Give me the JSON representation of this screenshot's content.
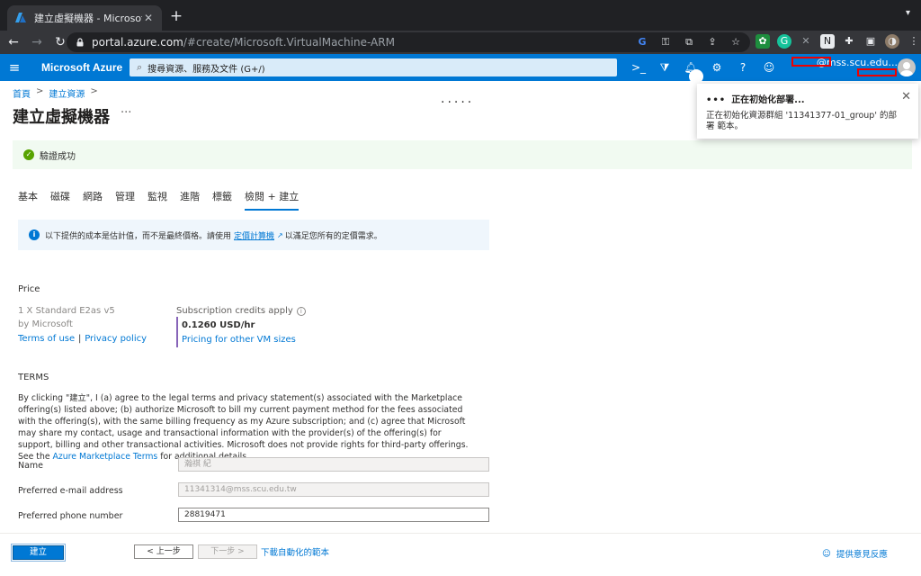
{
  "browser": {
    "tab_title": "建立虛擬機器 - Microsoft Azure",
    "tab_close": "✕",
    "new_tab": "+",
    "url_host": "portal.azure.com",
    "url_path": "/#create/Microsoft.VirtualMachine-ARM"
  },
  "header": {
    "brand": "Microsoft Azure",
    "search_placeholder": "搜尋資源、服務及文件 (G+/)",
    "notification_count": "1",
    "account": "@mss.scu.edu..."
  },
  "breadcrumb": {
    "home": "首頁",
    "create": "建立資源"
  },
  "page": {
    "title": "建立虛擬機器",
    "more": "···",
    "loading": "·····"
  },
  "validation": {
    "text": "驗證成功"
  },
  "tabs": [
    {
      "label": "基本"
    },
    {
      "label": "磁碟"
    },
    {
      "label": "網路"
    },
    {
      "label": "管理"
    },
    {
      "label": "監視"
    },
    {
      "label": "進階"
    },
    {
      "label": "標籤"
    },
    {
      "label": "檢閱 + 建立"
    }
  ],
  "info": {
    "prefix": "以下提供的成本是估計值，而不是最終價格。請使用",
    "link": "定價計算機",
    "suffix": "以滿足您所有的定價需求。"
  },
  "price": {
    "heading": "Price",
    "product": "1 X Standard E2as v5",
    "vendor": "by Microsoft",
    "terms_link": "Terms of use",
    "sep": "|",
    "privacy_link": "Privacy policy",
    "credits": "Subscription credits apply",
    "amount": "0.1260 USD/hr",
    "other_link": "Pricing for other VM sizes"
  },
  "terms": {
    "heading": "TERMS",
    "body": "By clicking \"建立\", I (a) agree to the legal terms and privacy statement(s) associated with the Marketplace offering(s) listed above; (b) authorize Microsoft to bill my current payment method for the fees associated with the offering(s), with the same billing frequency as my Azure subscription; and (c) agree that Microsoft may share my contact, usage and transactional information with the provider(s) of the offering(s) for support, billing and other transactional activities. Microsoft does not provide rights for third-party offerings. See the",
    "link": "Azure Marketplace Terms",
    "tail": "for additional details."
  },
  "form": {
    "name_label": "Name",
    "name_value": "瀚祺 紀",
    "email_label": "Preferred e-mail address",
    "email_value": "11341314@mss.scu.edu.tw",
    "phone_label": "Preferred phone number",
    "phone_value": "28819471"
  },
  "footer": {
    "create": "建立",
    "prev": "< 上一步",
    "next": "下一步 >",
    "download": "下載自動化的範本",
    "feedback": "提供意見反應"
  },
  "toast": {
    "title": "正在初始化部署...",
    "message": "正在初始化資源群組 '11341377-01_group' 的部署 範本。"
  },
  "colors": {
    "azure_blue": "#0078d4",
    "success": "#57a300",
    "highlight_red": "#e00000"
  }
}
